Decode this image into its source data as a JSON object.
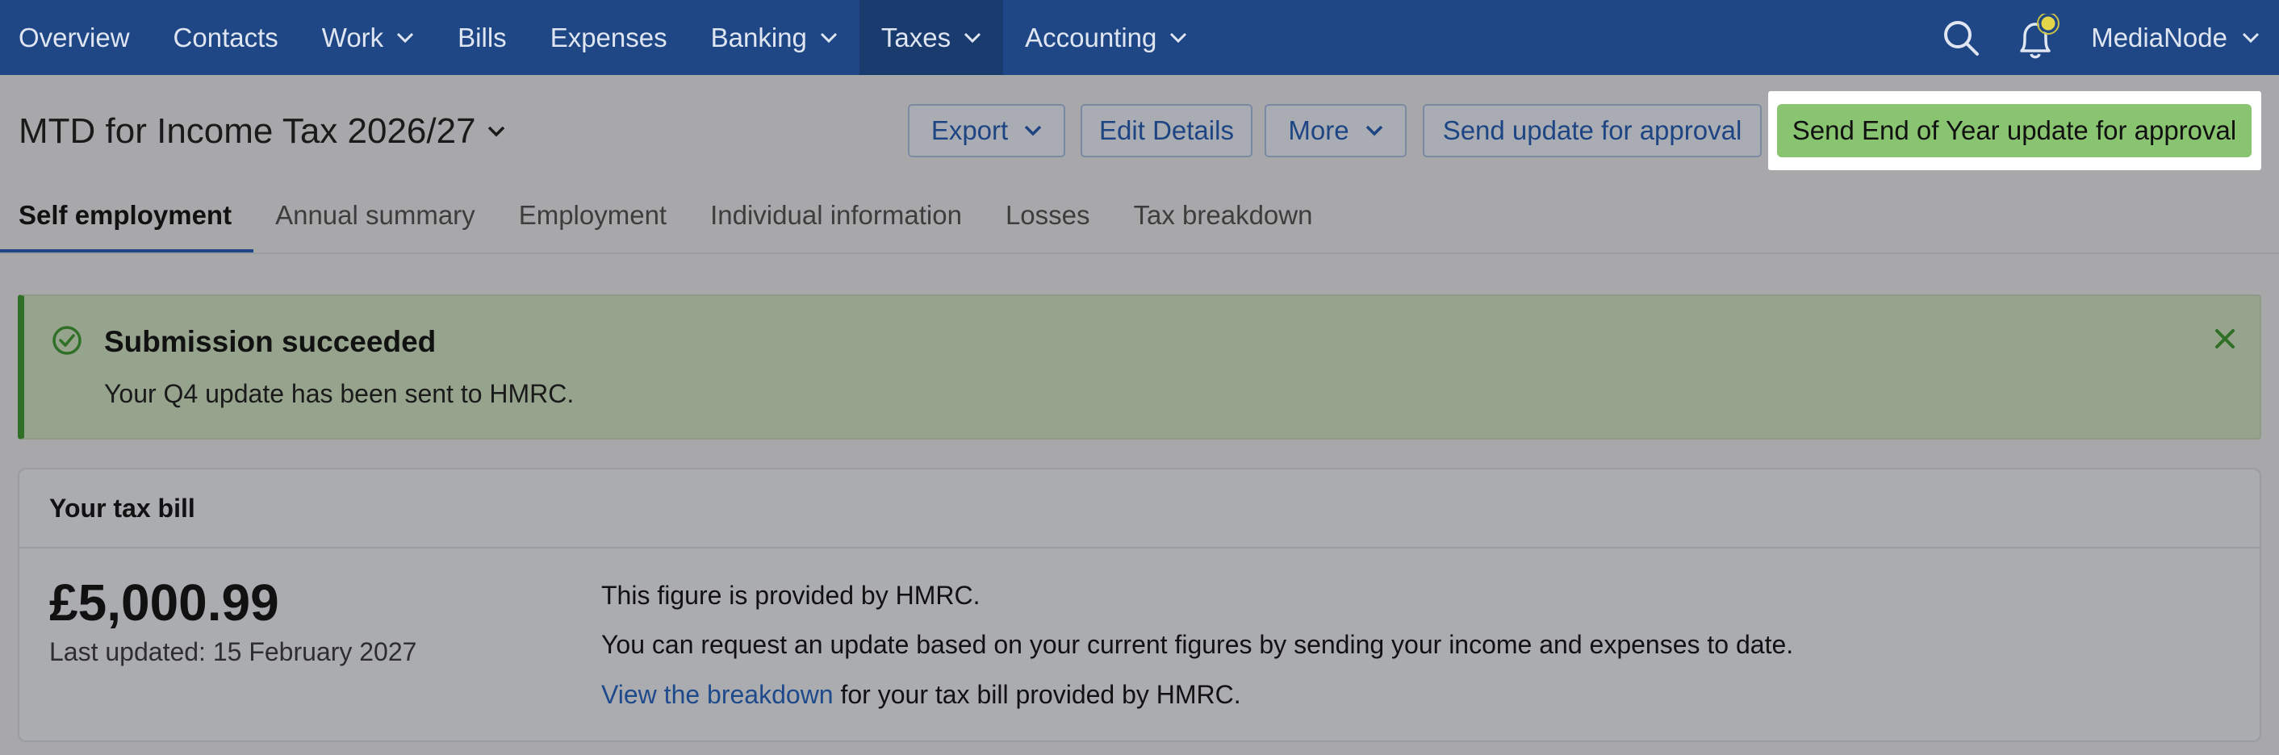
{
  "nav": {
    "items": [
      {
        "label": "Overview",
        "dropdown": false
      },
      {
        "label": "Contacts",
        "dropdown": false
      },
      {
        "label": "Work",
        "dropdown": true
      },
      {
        "label": "Bills",
        "dropdown": false
      },
      {
        "label": "Expenses",
        "dropdown": false
      },
      {
        "label": "Banking",
        "dropdown": true
      },
      {
        "label": "Taxes",
        "dropdown": true,
        "active": true
      },
      {
        "label": "Accounting",
        "dropdown": true
      }
    ],
    "org_name": "MediaNode",
    "icons": [
      "search-icon",
      "notification-bell-icon",
      "chevron-down-icon"
    ]
  },
  "header": {
    "title": "MTD for Income Tax 2026/27",
    "buttons": {
      "export": "Export",
      "edit_details": "Edit Details",
      "more": "More",
      "send_update": "Send update for approval",
      "send_eoy": "Send End of Year update for approval"
    }
  },
  "tabs": [
    {
      "label": "Self employment",
      "active": true
    },
    {
      "label": "Annual summary"
    },
    {
      "label": "Employment"
    },
    {
      "label": "Individual information"
    },
    {
      "label": "Losses"
    },
    {
      "label": "Tax breakdown"
    }
  ],
  "alert": {
    "title": "Submission succeeded",
    "message": "Your Q4 update has been sent to HMRC.",
    "icons": [
      "check-circle-icon",
      "close-icon"
    ]
  },
  "tax_bill": {
    "header": "Your tax bill",
    "amount": "£5,000.99",
    "last_updated": "Last updated: 15 February 2027",
    "info_1": "This figure is provided by HMRC.",
    "info_2": "You can request an update based on your current figures by sending your income and expenses to date.",
    "link_text": "View the breakdown",
    "info_3_rest": " for your tax bill provided by HMRC."
  },
  "colors": {
    "nav_bg": "#1f4785",
    "primary_button": "#89c570",
    "alert_accent": "#2f6f26",
    "link": "#1e4a8c"
  }
}
